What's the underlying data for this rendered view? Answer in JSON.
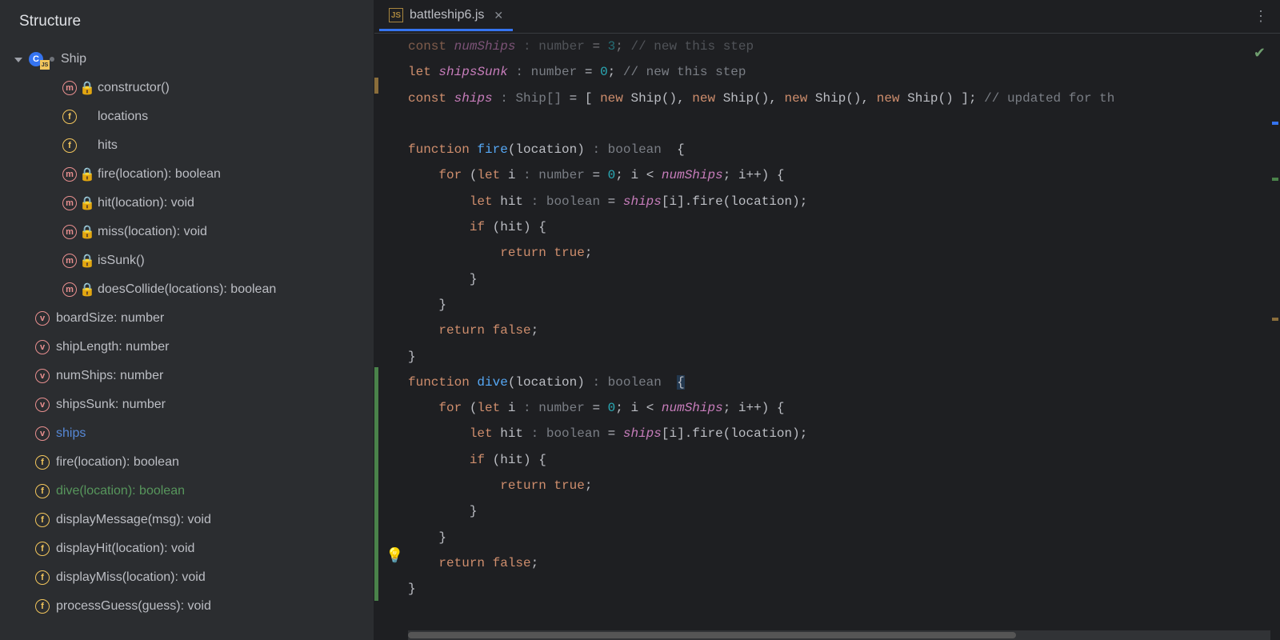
{
  "structure": {
    "title": "Structure",
    "root": {
      "label": "Ship"
    },
    "class_members": [
      {
        "kind": "m",
        "label": "constructor()"
      },
      {
        "kind": "f",
        "label": "locations"
      },
      {
        "kind": "f",
        "label": "hits"
      },
      {
        "kind": "m",
        "label": "fire(location): boolean"
      },
      {
        "kind": "m",
        "label": "hit(location): void"
      },
      {
        "kind": "m",
        "label": "miss(location): void"
      },
      {
        "kind": "m",
        "label": "isSunk()"
      },
      {
        "kind": "m",
        "label": "doesCollide(locations): boolean"
      }
    ],
    "file_members": [
      {
        "kind": "v",
        "label": "boardSize: number"
      },
      {
        "kind": "v",
        "label": "shipLength: number"
      },
      {
        "kind": "v",
        "label": "numShips: number"
      },
      {
        "kind": "v",
        "label": "shipsSunk: number"
      },
      {
        "kind": "v",
        "label": "ships",
        "highlight": true
      },
      {
        "kind": "fn",
        "label": "fire(location): boolean"
      },
      {
        "kind": "fn",
        "label": "dive(location): boolean",
        "selected": true
      },
      {
        "kind": "fn",
        "label": "displayMessage(msg): void"
      },
      {
        "kind": "fn",
        "label": "displayHit(location): void"
      },
      {
        "kind": "fn",
        "label": "displayMiss(location): void"
      },
      {
        "kind": "fn",
        "label": "processGuess(guess): void"
      }
    ]
  },
  "tab": {
    "filename": "battleship6.js"
  },
  "code": {
    "l1_a": "const ",
    "l1_b": "numShips",
    "l1_c": " : ",
    "l1_d": "number",
    "l1_e": " = ",
    "l1_f": "3",
    "l1_g": "; ",
    "l1_h": "// new this step",
    "l2_a": "let ",
    "l2_b": "shipsSunk",
    "l2_c": " : ",
    "l2_d": "number",
    "l2_e": " = ",
    "l2_f": "0",
    "l2_g": "; ",
    "l2_h": "// new this step",
    "l3_a": "const ",
    "l3_b": "ships",
    "l3_c": " : ",
    "l3_d": "Ship[]",
    "l3_e": " = [ ",
    "l3_f": "new ",
    "l3_g": "Ship(), ",
    "l3_h": "new ",
    "l3_i": "Ship(), ",
    "l3_j": "new ",
    "l3_k": "Ship(), ",
    "l3_l": "new ",
    "l3_m": "Ship() ]; ",
    "l3_n": "// updated for th",
    "l5_a": "function ",
    "l5_b": "fire",
    "l5_c": "(location)",
    "l5_d": " : ",
    "l5_e": "boolean",
    "l5_f": "  {",
    "l6_a": "    for ",
    "l6_b": "(",
    "l6_c": "let ",
    "l6_d": "i",
    "l6_e": " : ",
    "l6_f": "number",
    "l6_g": " = ",
    "l6_h": "0",
    "l6_i": "; i < ",
    "l6_j": "numShips",
    "l6_k": "; i++) {",
    "l7_a": "        let ",
    "l7_b": "hit",
    "l7_c": " : ",
    "l7_d": "boolean",
    "l7_e": " = ",
    "l7_f": "ships",
    "l7_g": "[i].",
    "l7_h": "fire",
    "l7_i": "(location);",
    "l8_a": "        if ",
    "l8_b": "(hit) {",
    "l9_a": "            return true",
    "l9_b": ";",
    "l10_a": "        }",
    "l11_a": "    }",
    "l12_a": "    return false",
    "l12_b": ";",
    "l13_a": "}",
    "l14_a": "function ",
    "l14_b": "dive",
    "l14_c": "(location)",
    "l14_d": " : ",
    "l14_e": "boolean",
    "l14_f": "  ",
    "l14_g": "{",
    "l15_a": "    for ",
    "l15_b": "(",
    "l15_c": "let ",
    "l15_d": "i",
    "l15_e": " : ",
    "l15_f": "number",
    "l15_g": " = ",
    "l15_h": "0",
    "l15_i": "; i < ",
    "l15_j": "numShips",
    "l15_k": "; i++) {",
    "l16_a": "        let ",
    "l16_b": "hit",
    "l16_c": " : ",
    "l16_d": "boolean",
    "l16_e": " = ",
    "l16_f": "ships",
    "l16_g": "[i].",
    "l16_h": "fire",
    "l16_i": "(location);",
    "l17_a": "        if ",
    "l17_b": "(hit) {",
    "l18_a": "            return true",
    "l18_b": ";",
    "l19_a": "        }",
    "l20_a": "    }",
    "l21_a": "    return false",
    "l21_b": ";",
    "l22_a": "}"
  }
}
